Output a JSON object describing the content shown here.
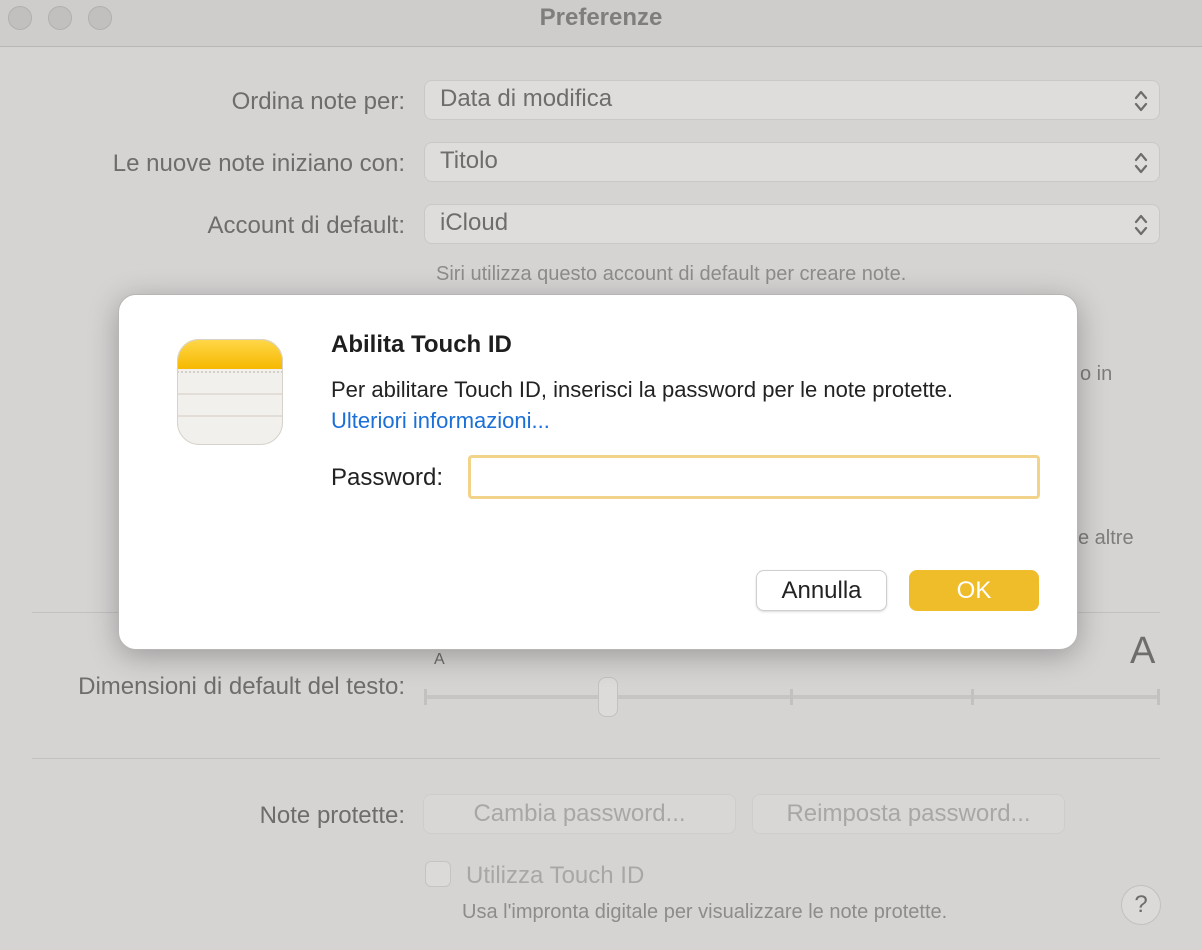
{
  "window": {
    "title": "Preferenze"
  },
  "prefs": {
    "sort_label": "Ordina note per:",
    "sort_value": "Data di modifica",
    "new_notes_label": "Le nuove note iniziano con:",
    "new_notes_value": "Titolo",
    "account_label": "Account di default:",
    "account_value": "iCloud",
    "account_note": "Siri utilizza questo account di default per creare note.",
    "hidden_text_1": "o in",
    "hidden_text_2": "e altre",
    "text_size_label": "Dimensioni di default del testo:",
    "text_size_small": "A",
    "text_size_large": "A",
    "text_size_level": 0.25,
    "locked_notes_label": "Note protette:",
    "change_password": "Cambia password...",
    "reset_password": "Reimposta password...",
    "touch_id_label": "Utilizza Touch ID",
    "touch_id_note": "Usa l'impronta digitale per visualizzare le note protette.",
    "help": "?"
  },
  "dialog": {
    "title": "Abilita Touch ID",
    "body": "Per abilitare Touch ID, inserisci la password per le note protette.",
    "link": "Ulteriori informazioni...",
    "password_label": "Password:",
    "password_value": "",
    "cancel": "Annulla",
    "ok": "OK",
    "app_icon": "notes-app-icon"
  },
  "colors": {
    "accent": "#efbd29",
    "link": "#1b6fd8",
    "focus_ring": "#f1d389"
  }
}
